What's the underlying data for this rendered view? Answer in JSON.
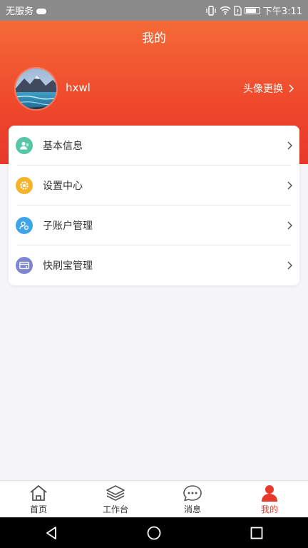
{
  "status_bar": {
    "carrier": "无服务",
    "time": "下午3:11"
  },
  "header": {
    "title": "我的",
    "username": "hxwl",
    "avatar_change_label": "头像更换"
  },
  "menu": {
    "items": [
      {
        "label": "基本信息",
        "icon": "user-info-icon",
        "color": "#57c5a6"
      },
      {
        "label": "设置中心",
        "icon": "settings-icon",
        "color": "#f5b32a"
      },
      {
        "label": "子账户管理",
        "icon": "sub-account-icon",
        "color": "#3fa5e9"
      },
      {
        "label": "快刷宝管理",
        "icon": "card-icon",
        "color": "#7f86cf"
      }
    ]
  },
  "tabbar": {
    "tabs": [
      {
        "label": "首页",
        "icon": "home-icon"
      },
      {
        "label": "工作台",
        "icon": "layers-icon"
      },
      {
        "label": "消息",
        "icon": "message-icon"
      },
      {
        "label": "我的",
        "icon": "person-icon",
        "active": true
      }
    ]
  },
  "colors": {
    "accent": "#e8382a",
    "header_top": "#f56a38",
    "background": "#f5f5f7"
  }
}
